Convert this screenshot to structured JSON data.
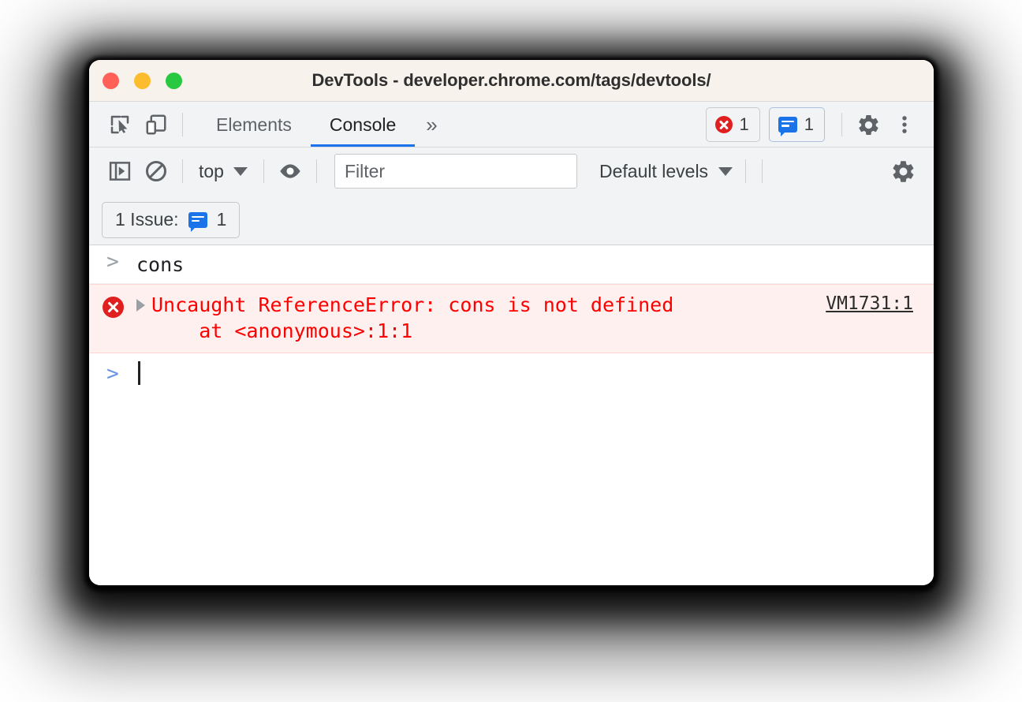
{
  "window": {
    "title": "DevTools - developer.chrome.com/tags/devtools/",
    "traffic_lights": [
      {
        "name": "close",
        "color": "#ff6159"
      },
      {
        "name": "minimize",
        "color": "#fcbc2e"
      },
      {
        "name": "maximize",
        "color": "#28c840"
      }
    ]
  },
  "tabbar": {
    "inspect_icon": "inspect-element-icon",
    "device_icon": "device-toolbar-icon",
    "tabs": [
      {
        "label": "Elements",
        "active": false
      },
      {
        "label": "Console",
        "active": true
      }
    ],
    "more_tabs_label": "»",
    "error_count": "1",
    "message_count": "1",
    "settings_icon": "gear-icon",
    "more_icon": "kebab-menu-icon",
    "active_accent": "#1a73e8"
  },
  "console_toolbar": {
    "sidebar_icon": "console-sidebar-icon",
    "clear_icon": "clear-console-icon",
    "context_label": "top",
    "eye_icon": "live-expression-eye-icon",
    "filter_placeholder": "Filter",
    "filter_value": "",
    "levels_label": "Default levels",
    "settings_icon": "gear-icon"
  },
  "issues_bar": {
    "label": "1 Issue:",
    "count": "1"
  },
  "console": {
    "entries": [
      {
        "type": "input",
        "prompt": ">",
        "text": "cons"
      },
      {
        "type": "error",
        "prompt": "▸",
        "text": "Uncaught ReferenceError: cons is not defined\n    at <anonymous>:1:1",
        "link": "VM1731:1",
        "bg": "#fff0f0",
        "fg": "#ff0000"
      },
      {
        "type": "prompt",
        "prompt": ">",
        "text": ""
      }
    ]
  },
  "colors": {
    "titlebar_bg": "#f7f2ec",
    "toolbar_bg": "#f1f3f4",
    "console_bg": "#ffffff",
    "accent_blue": "#1a73e8",
    "error_red": "#e02020"
  }
}
